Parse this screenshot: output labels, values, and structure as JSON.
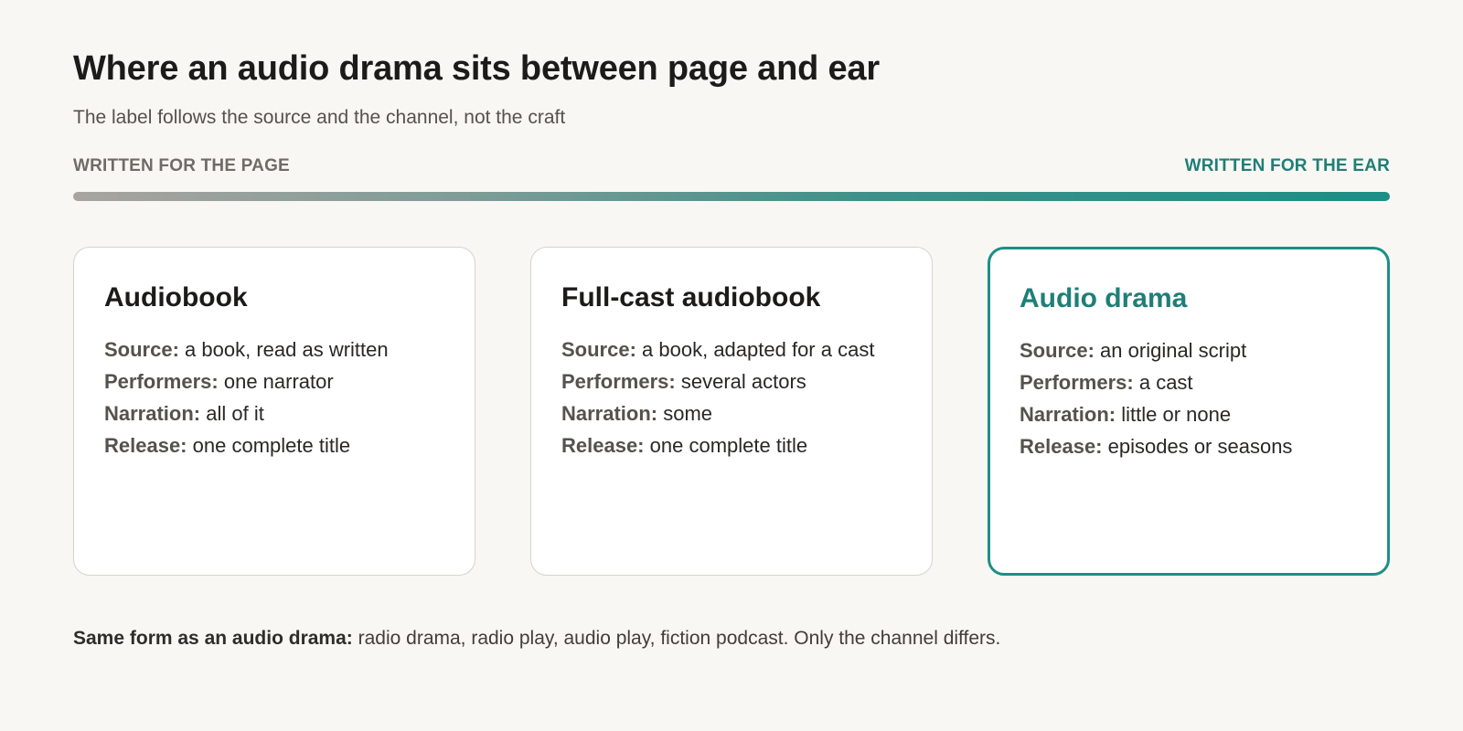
{
  "header": {
    "title": "Where an audio drama sits between page and ear",
    "subtitle": "The label follows the source and the channel, not the craft"
  },
  "spectrum": {
    "left_label": "WRITTEN FOR THE PAGE",
    "right_label": "WRITTEN FOR THE EAR",
    "colors": {
      "start": "#a8a49f",
      "end": "#1b8f86"
    }
  },
  "cards": [
    {
      "title": "Audiobook",
      "rows": [
        {
          "key": "Source:",
          "value": "a book, read as written"
        },
        {
          "key": "Performers:",
          "value": "one narrator"
        },
        {
          "key": "Narration:",
          "value": "all of it"
        },
        {
          "key": "Release:",
          "value": "one complete title"
        }
      ]
    },
    {
      "title": "Full-cast audiobook",
      "rows": [
        {
          "key": "Source:",
          "value": "a book, adapted for a cast"
        },
        {
          "key": "Performers:",
          "value": "several actors"
        },
        {
          "key": "Narration:",
          "value": "some"
        },
        {
          "key": "Release:",
          "value": "one complete title"
        }
      ]
    },
    {
      "title": "Audio drama",
      "highlighted": true,
      "rows": [
        {
          "key": "Source:",
          "value": "an original script"
        },
        {
          "key": "Performers:",
          "value": "a cast"
        },
        {
          "key": "Narration:",
          "value": "little or none"
        },
        {
          "key": "Release:",
          "value": "episodes or seasons"
        }
      ]
    }
  ],
  "footnote": {
    "lead": "Same form as an audio drama:",
    "text": "radio drama, radio play, audio play, fiction podcast. Only the channel differs."
  },
  "colors": {
    "accent": "#1b8f86",
    "accent_text": "#1e7f77",
    "background": "#f9f7f3"
  }
}
